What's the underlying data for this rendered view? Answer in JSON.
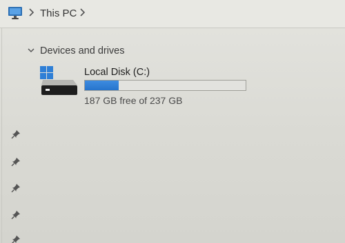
{
  "address_bar": {
    "location_icon": "this-pc-monitor-icon",
    "breadcrumb": [
      "This PC"
    ]
  },
  "sidebar": {
    "pin_icon": "pin-icon",
    "pinned_count": 5
  },
  "main": {
    "group": {
      "title": "Devices and drives",
      "expanded": true
    },
    "drives": [
      {
        "name": "Local Disk (C:)",
        "free_text": "187 GB free of 237 GB",
        "used_fraction": 0.21,
        "icon": "windows-drive-icon"
      }
    ]
  },
  "colors": {
    "accent": "#2674cc",
    "bar_track": "#e2e2de",
    "bar_border": "#9e9e98"
  }
}
